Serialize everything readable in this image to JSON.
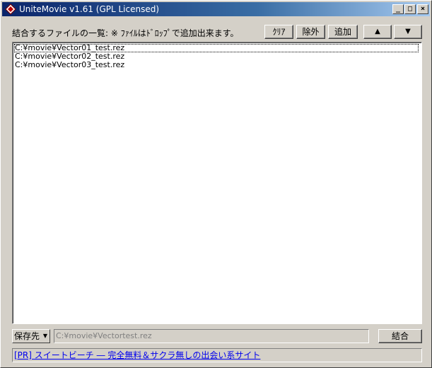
{
  "window": {
    "title": "UniteMovie v1.61 (GPL Licensed)",
    "controls": {
      "minimize": "_",
      "maximize": "□",
      "close": "×"
    }
  },
  "list_section": {
    "label": "結合するファイルの一覧: ※ ﾌｧｲﾙはﾄﾞﾛｯﾌﾟで追加出来ます。",
    "buttons": {
      "clear": "ｸﾘｱ",
      "remove": "除外",
      "add": "追加",
      "up": "▲",
      "down": "▼"
    },
    "files": [
      "C:¥movie¥Vector01_test.rez",
      "C:¥movie¥Vector02_test.rez",
      "C:¥movie¥Vector03_test.rez"
    ]
  },
  "output": {
    "save_label": "保存先",
    "path": "C:¥movie¥Vectortest.rez",
    "combine_label": "結合"
  },
  "ad": {
    "text": "[PR] スイートビーチ ― 完全無料＆サクラ無しの出会い系サイト"
  },
  "colors": {
    "face": "#d4d0c8",
    "title_start": "#0a246a",
    "title_end": "#a6caf0",
    "link": "#0000ee"
  }
}
